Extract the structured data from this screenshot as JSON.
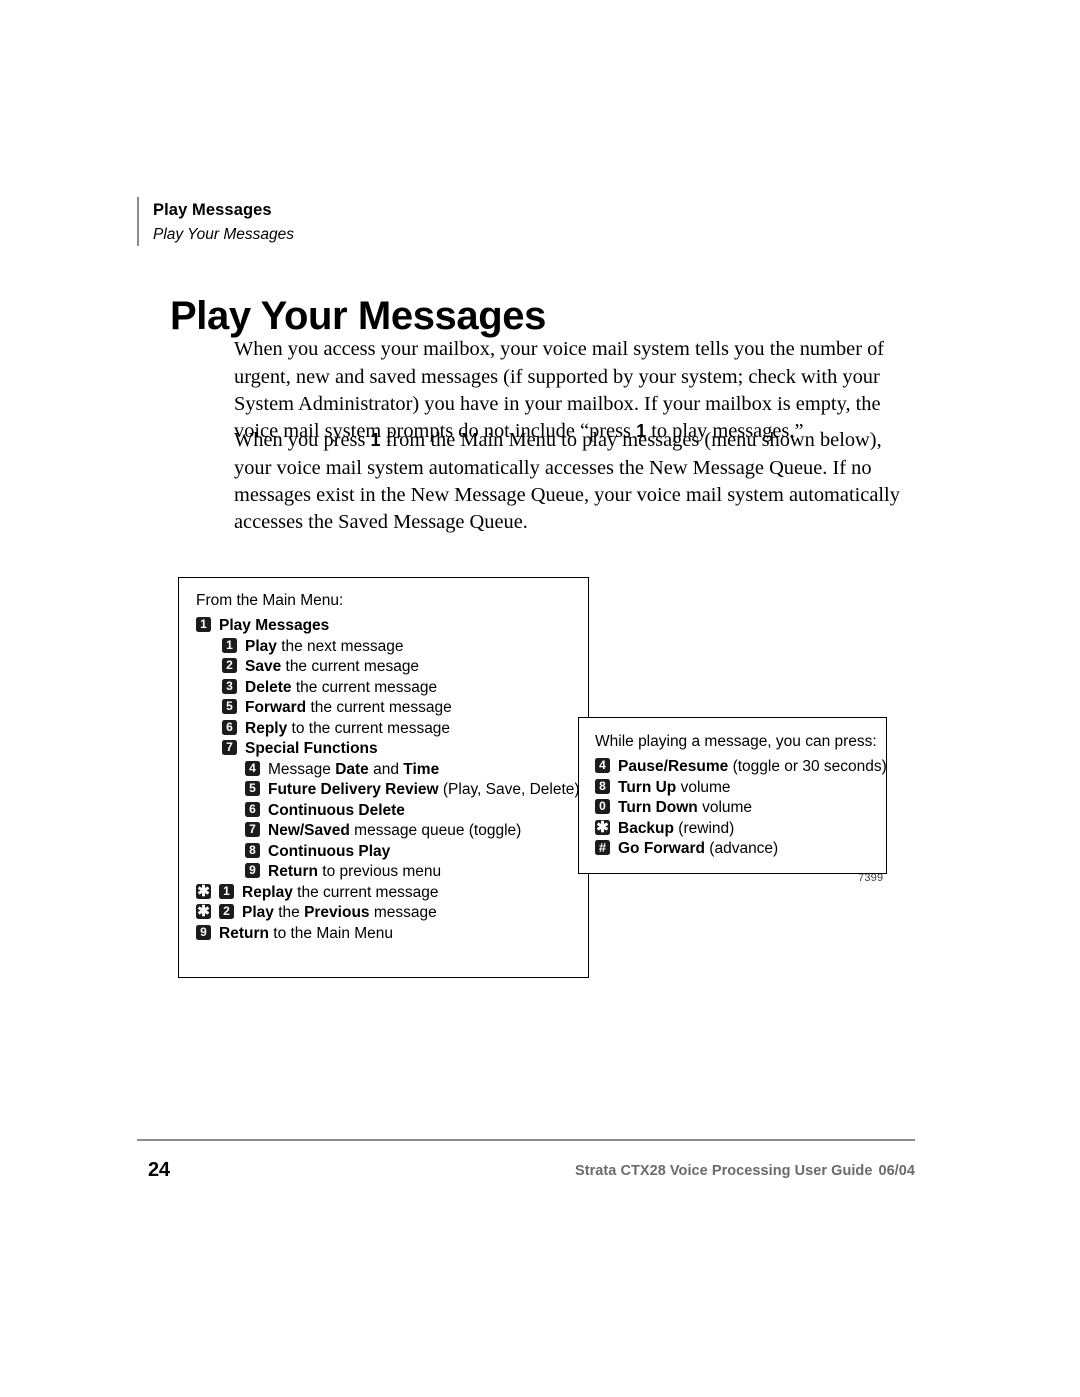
{
  "header": {
    "chapter": "Play Messages",
    "section": "Play Your Messages"
  },
  "title": "Play Your Messages",
  "paragraphs": {
    "p1_a": "When you access your mailbox, your voice mail system tells you the number of urgent, new and saved messages (if supported by your system; check with your System Administrator) you have in your mailbox. If your mailbox is empty, the voice mail system prompts do not include “press ",
    "p1_key": "1",
    "p1_b": " to play messages.”",
    "p2_a": "When you press ",
    "p2_key": "1",
    "p2_b": " from the Main Menu to play messages (menu shown below), your voice mail system automatically accesses the New Message Queue. If no messages exist in the New Message Queue, your voice mail system automatically accesses the Saved Message Queue."
  },
  "main_menu_box": {
    "intro": "From the Main Menu:",
    "rows": [
      {
        "level": 0,
        "keys": [
          "1"
        ],
        "bold": "Play Messages",
        "plain": ""
      },
      {
        "level": 1,
        "keys": [
          "1"
        ],
        "bold": "Play",
        "plain": " the next message"
      },
      {
        "level": 1,
        "keys": [
          "2"
        ],
        "bold": "Save",
        "plain": " the current mesage"
      },
      {
        "level": 1,
        "keys": [
          "3"
        ],
        "bold": "Delete",
        "plain": " the current message"
      },
      {
        "level": 1,
        "keys": [
          "5"
        ],
        "bold": "Forward",
        "plain": " the current message"
      },
      {
        "level": 1,
        "keys": [
          "6"
        ],
        "bold": "Reply",
        "plain": " to the current message"
      },
      {
        "level": 1,
        "keys": [
          "7"
        ],
        "bold": "Special Functions",
        "plain": ""
      },
      {
        "level": 2,
        "keys": [
          "4"
        ],
        "bold": "",
        "plain": "Message ",
        "bold2": "Date",
        "plain2": " and ",
        "bold3": "Time"
      },
      {
        "level": 2,
        "keys": [
          "5"
        ],
        "bold": "Future Delivery Review",
        "plain": " (Play, Save, Delete)"
      },
      {
        "level": 2,
        "keys": [
          "6"
        ],
        "bold": "Continuous Delete",
        "plain": ""
      },
      {
        "level": 2,
        "keys": [
          "7"
        ],
        "bold": "New/Saved",
        "plain": " message queue (toggle)"
      },
      {
        "level": 2,
        "keys": [
          "8"
        ],
        "bold": "Continuous Play",
        "plain": ""
      },
      {
        "level": 2,
        "keys": [
          "9"
        ],
        "bold": "Return",
        "plain": " to previous menu"
      },
      {
        "level": 0,
        "keys": [
          "*",
          "1"
        ],
        "bold": "Replay",
        "plain": " the current message"
      },
      {
        "level": 0,
        "keys": [
          "*",
          "2"
        ],
        "bold": "Play",
        "plain": " the ",
        "bold2": "Previous",
        "plain2": " message"
      },
      {
        "level": 0,
        "keys": [
          "9"
        ],
        "bold": "Return",
        "plain": " to the Main Menu"
      }
    ]
  },
  "playing_box": {
    "intro": "While playing a message, you can press:",
    "rows": [
      {
        "keys": [
          "4"
        ],
        "bold": "Pause/Resume",
        "plain": " (toggle or 30 seconds)"
      },
      {
        "keys": [
          "8"
        ],
        "bold": "Turn Up",
        "plain": " volume"
      },
      {
        "keys": [
          "0"
        ],
        "bold": "Turn Down",
        "plain": " volume"
      },
      {
        "keys": [
          "*"
        ],
        "bold": "Backup",
        "plain": " (rewind)"
      },
      {
        "keys": [
          "#"
        ],
        "bold": "Go Forward",
        "plain": " (advance)"
      }
    ]
  },
  "figure_number": "7399",
  "footer": {
    "page_number": "24",
    "guide": "Strata CTX28 Voice Processing User Guide",
    "date": "06/04"
  }
}
